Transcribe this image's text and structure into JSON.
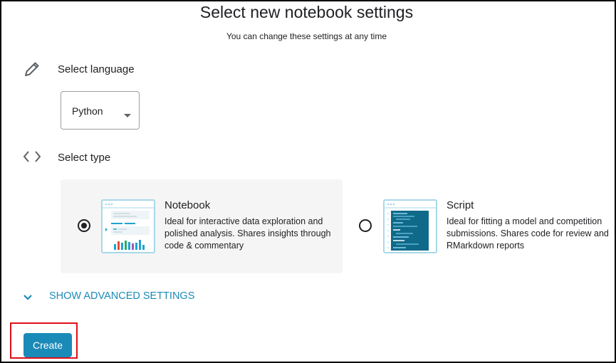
{
  "header": {
    "title": "Select new notebook settings",
    "subtitle": "You can change these settings at any time"
  },
  "language_section": {
    "icon": "pencil-icon",
    "label": "Select language",
    "dropdown_value": "Python"
  },
  "type_section": {
    "icon": "code-brackets-icon",
    "label": "Select type",
    "options": [
      {
        "title": "Notebook",
        "description": "Ideal for interactive data exploration and polished analysis. Shares insights through code & commentary",
        "selected": true
      },
      {
        "title": "Script",
        "description": "Ideal for fitting a model and competition submissions. Shares code for review and RMarkdown reports",
        "selected": false
      }
    ]
  },
  "advanced": {
    "label": "SHOW ADVANCED SETTINGS",
    "icon": "chevron-down-icon"
  },
  "actions": {
    "create_label": "Create"
  },
  "colors": {
    "accent": "#1a8ab8",
    "selected_card_bg": "#f5f5f5",
    "highlight_box": "#e0101a"
  }
}
